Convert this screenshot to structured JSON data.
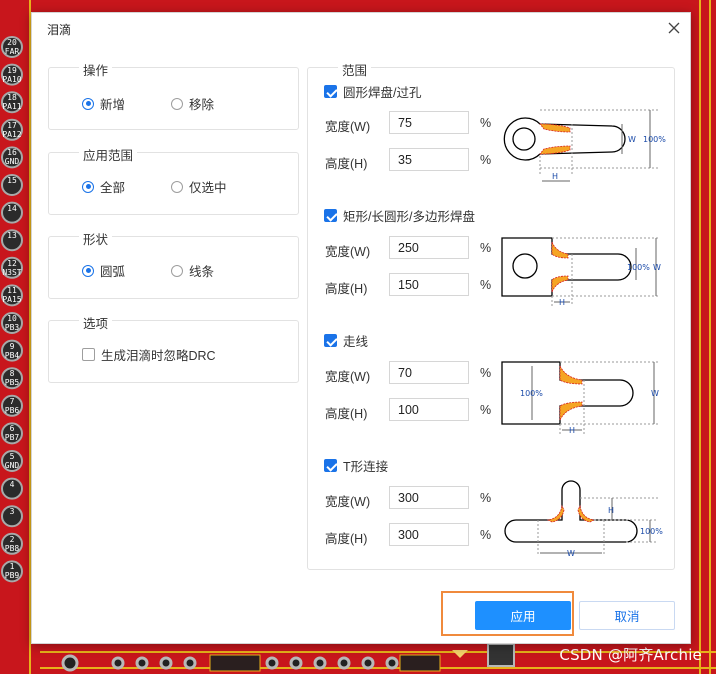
{
  "dialog": {
    "title": "泪滴"
  },
  "operation": {
    "legend": "操作",
    "options": [
      "新增",
      "移除"
    ],
    "selected": 0
  },
  "apply_scope": {
    "legend": "应用范围",
    "options": [
      "全部",
      "仅选中"
    ],
    "selected": 0
  },
  "shape": {
    "legend": "形状",
    "options": [
      "圆弧",
      "线条"
    ],
    "selected": 0
  },
  "options_group": {
    "legend": "选项",
    "ignore_drc_label": "生成泪滴时忽略DRC",
    "ignore_drc_checked": false
  },
  "scope": {
    "legend": "范围",
    "unit": "%",
    "width_label": "宽度(W)",
    "height_label": "高度(H)",
    "sections": [
      {
        "label": "圆形焊盘/过孔",
        "checked": true,
        "width": "75",
        "height": "35"
      },
      {
        "label": "矩形/长圆形/多边形焊盘",
        "checked": true,
        "width": "250",
        "height": "150"
      },
      {
        "label": "走线",
        "checked": true,
        "width": "70",
        "height": "100"
      },
      {
        "label": "T形连接",
        "checked": true,
        "width": "300",
        "height": "300"
      }
    ],
    "diagram_labels": {
      "w": "W",
      "h": "H",
      "hundred": "100%"
    }
  },
  "buttons": {
    "apply": "应用",
    "cancel": "取消"
  },
  "pcb": {
    "pin_labels": [
      [
        "20",
        "FAR"
      ],
      [
        "19",
        "PA10"
      ],
      [
        "18",
        "PA11"
      ],
      [
        "17",
        "PA12"
      ],
      [
        "16",
        "GND"
      ],
      [
        "15",
        ""
      ],
      [
        "14",
        ""
      ],
      [
        "13",
        ""
      ],
      [
        "12",
        "N3ST"
      ],
      [
        "11",
        "PA15"
      ],
      [
        "10",
        "PB3"
      ],
      [
        "9",
        "PB4"
      ],
      [
        "8",
        "PB5"
      ],
      [
        "7",
        "PB6"
      ],
      [
        "6",
        "PB7"
      ],
      [
        "5",
        "GND"
      ],
      [
        "4",
        ""
      ],
      [
        "3",
        ""
      ],
      [
        "2",
        "PB8"
      ],
      [
        "1",
        "PB9"
      ]
    ],
    "watermark": "CSDN @阿齐Archie"
  },
  "colors": {
    "accent": "#1a73e8",
    "primary_button": "#1e90ff",
    "highlight": "#f08a3c",
    "pcb_red": "#c8161c",
    "pcb_copper": "#f1c40f"
  }
}
